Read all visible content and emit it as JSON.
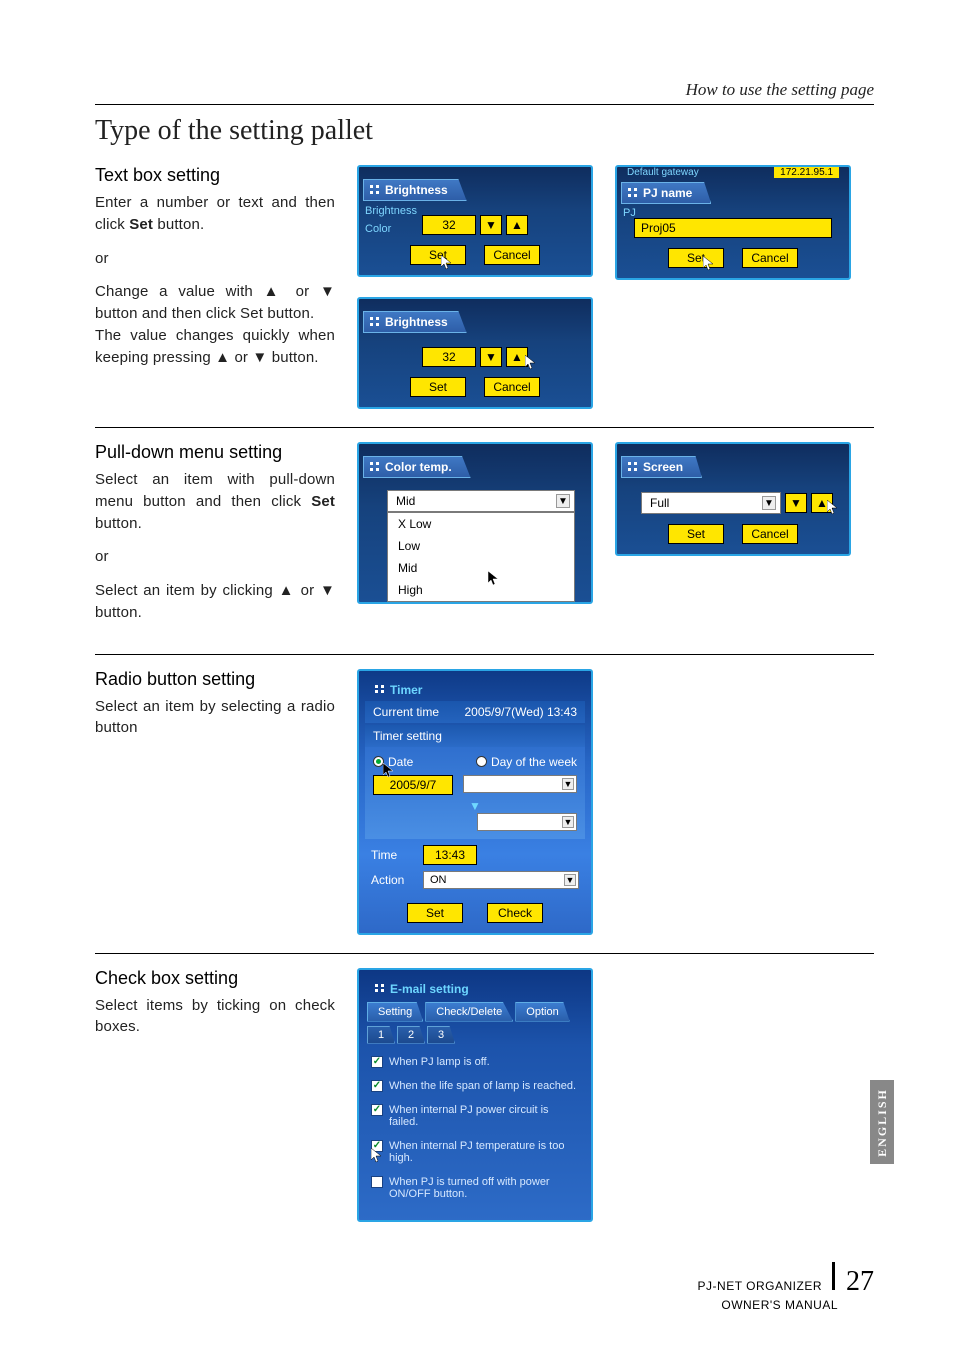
{
  "header": {
    "right": "How to use the setting page"
  },
  "h1": "Type of the setting pallet",
  "sec1": {
    "title": "Text box setting",
    "p1a": "Enter a number or text and then click ",
    "p1b": "Set",
    "p1c": " button.",
    "or": "or",
    "p2": "Change a value with ▲ or ▼ button and then click Set button.",
    "p3": "The value changes quickly when keeping pressing ▲ or ▼ button.",
    "panel1": {
      "title": "Brightness",
      "value": "32",
      "set": "Set",
      "cancel": "Cancel",
      "side1": "Brightness",
      "side2": "Color"
    },
    "panel2": {
      "title": "Brightness",
      "value": "32",
      "set": "Set",
      "cancel": "Cancel"
    },
    "panel3": {
      "title": "PJ name",
      "gateway_label": "Default gateway",
      "gateway_val": "172.21.95.1",
      "value": "Proj05",
      "set": "Set",
      "cancel": "Cancel",
      "side": "PJ"
    }
  },
  "sec2": {
    "title": "Pull-down menu setting",
    "p1a": "Select an item with pull-down menu button and then click ",
    "p1b": "Set",
    "p1c": " button.",
    "or": "or",
    "p2": "Select an item by clicking ▲ or ▼ button.",
    "panel1": {
      "title": "Color temp.",
      "selected": "Mid",
      "options": [
        "X Low",
        "Low",
        "Mid",
        "High"
      ]
    },
    "panel2": {
      "title": "Screen",
      "selected": "Full",
      "set": "Set",
      "cancel": "Cancel"
    }
  },
  "sec3": {
    "title": "Radio button setting",
    "p1": "Select an item by selecting a radio button",
    "panel": {
      "title": "Timer",
      "ct_label": "Current time",
      "ct_value": "2005/9/7(Wed) 13:43",
      "ts_label": "Timer setting",
      "radio_date": "Date",
      "radio_dow": "Day of the week",
      "date_value": "2005/9/7",
      "time_label": "Time",
      "time_value": "13:43",
      "action_label": "Action",
      "action_value": "ON",
      "set": "Set",
      "check": "Check"
    }
  },
  "sec4": {
    "title": "Check box setting",
    "p1": "Select items by ticking on check boxes.",
    "panel": {
      "title": "E-mail setting",
      "tabs": [
        "Setting",
        "Check/Delete",
        "Option"
      ],
      "subtabs": [
        "1",
        "2",
        "3"
      ],
      "items": [
        {
          "checked": true,
          "text": "When PJ lamp is off."
        },
        {
          "checked": true,
          "text": "When the life span of lamp is reached."
        },
        {
          "checked": true,
          "text": "When internal PJ power circuit is failed."
        },
        {
          "checked": true,
          "text": "When internal PJ temperature is too high."
        },
        {
          "checked": false,
          "text": "When PJ is turned off with power ON/OFF button."
        }
      ]
    }
  },
  "footer": {
    "product": "PJ-NET ORGANIZER",
    "page": "27",
    "sub": "OWNER'S MANUAL"
  },
  "side": "ENGLISH",
  "glyphs": {
    "down": "▼",
    "up": "▲",
    "check": "✓"
  }
}
